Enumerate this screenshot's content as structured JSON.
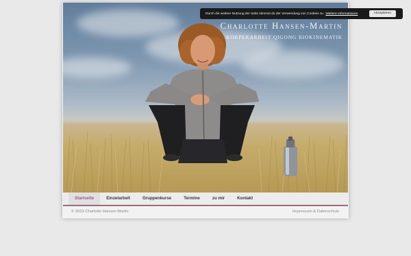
{
  "site": {
    "title": "Charlotte Hansen-Martin",
    "subtitle": "Körperarbeit Qigong Biokinematik"
  },
  "cookie_banner": {
    "text": "Durch die weitere Nutzung der Seite stimmst du der Verwendung von Cookies zu.",
    "link_label": "Weitere Informationen",
    "accept_label": "Akzeptieren"
  },
  "nav": {
    "items": [
      {
        "label": "Startseite",
        "active": true
      },
      {
        "label": "Einzelarbeit"
      },
      {
        "label": "Gruppenkurse"
      },
      {
        "label": "Termine"
      },
      {
        "label": "zu mir"
      },
      {
        "label": "Kontakt"
      }
    ]
  },
  "footer": {
    "copyright": "© 2023 Charlotte Hansen-Martin",
    "legal_link": "Impressum & Datenschutz"
  },
  "colors": {
    "accent": "#a05a73",
    "nav_border": "#9c6a7a",
    "cookie_bg": "#1a1a1a"
  }
}
